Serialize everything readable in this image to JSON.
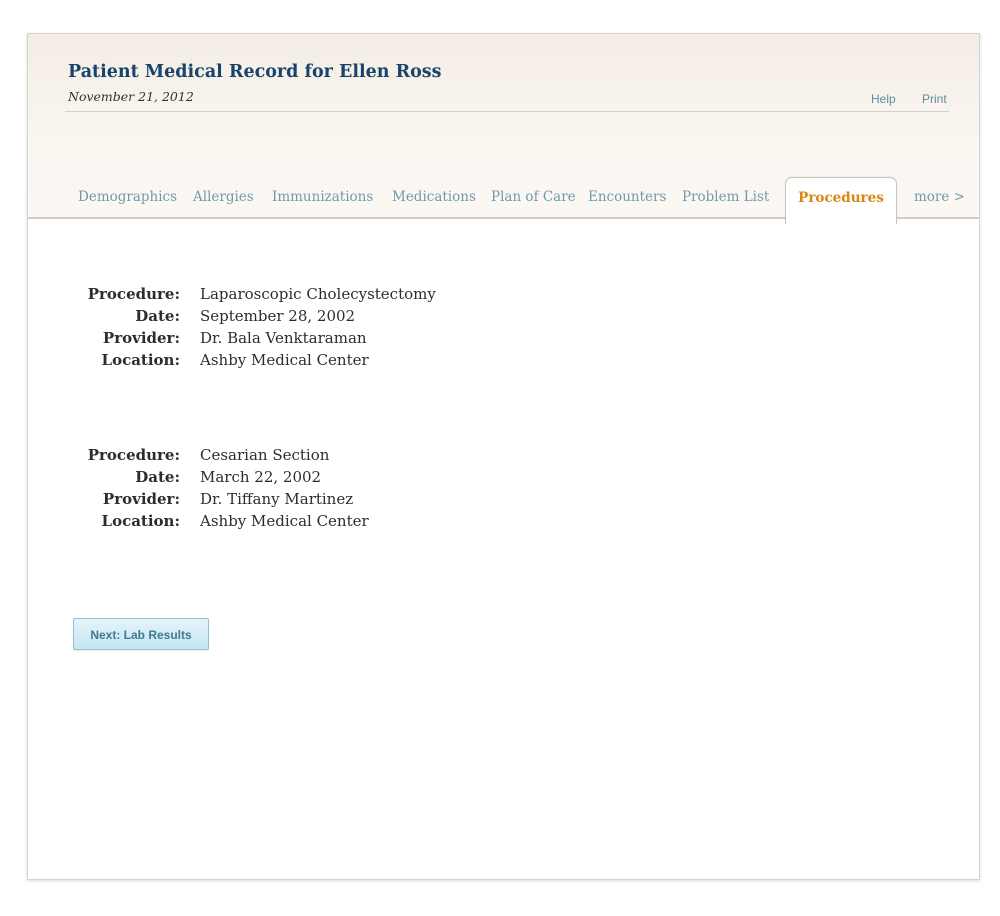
{
  "header": {
    "title": "Patient Medical Record for Ellen Ross",
    "date": "November 21, 2012",
    "links": {
      "help": "Help",
      "print": "Print"
    }
  },
  "tabs": [
    {
      "label": "Demographics"
    },
    {
      "label": "Allergies"
    },
    {
      "label": "Immunizations"
    },
    {
      "label": "Medications"
    },
    {
      "label": "Plan of Care"
    },
    {
      "label": "Encounters"
    },
    {
      "label": "Problem List"
    },
    {
      "label": "Procedures",
      "active": true
    },
    {
      "label": "more >"
    }
  ],
  "procedures": [
    {
      "procedure": {
        "label": "Procedure:",
        "value": "Laparoscopic Cholecystectomy"
      },
      "date": {
        "label": "Date:",
        "value": "September 28, 2002"
      },
      "provider": {
        "label": "Provider:",
        "value": "Dr. Bala Venktaraman"
      },
      "location": {
        "label": "Location:",
        "value": "Ashby Medical Center"
      }
    },
    {
      "procedure": {
        "label": "Procedure:",
        "value": "Cesarian Section"
      },
      "date": {
        "label": "Date:",
        "value": "March 22, 2002"
      },
      "provider": {
        "label": "Provider:",
        "value": "Dr. Tiffany Martinez"
      },
      "location": {
        "label": "Location:",
        "value": "Ashby Medical Center"
      }
    }
  ],
  "next_button": {
    "label": "Next: Lab Results"
  },
  "colors": {
    "title": "#17436c",
    "tab_link": "#6f9aac",
    "tab_active": "#da8710",
    "util_link": "#5e8ca0",
    "button_text": "#3e7b95",
    "button_border": "#93c4d8"
  }
}
